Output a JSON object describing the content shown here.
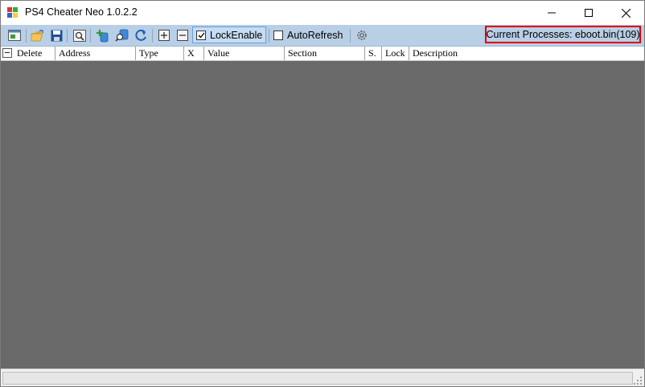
{
  "window": {
    "title": "PS4 Cheater Neo 1.0.2.2",
    "controls": {
      "minimize": "minimize",
      "maximize": "maximize",
      "close": "close"
    }
  },
  "toolbar": {
    "buttons": [
      {
        "name": "new-icon"
      },
      {
        "name": "open-folder-icon"
      },
      {
        "name": "save-icon"
      },
      {
        "name": "search-icon"
      },
      {
        "name": "add-address-icon"
      },
      {
        "name": "pointer-search-icon"
      },
      {
        "name": "refresh-icon"
      },
      {
        "name": "expand-all-icon"
      },
      {
        "name": "collapse-all-icon"
      }
    ],
    "lock_enable": {
      "label": "LockEnable",
      "checked": true
    },
    "auto_refresh": {
      "label": "AutoRefresh",
      "checked": false
    },
    "settings_icon": "gear-icon",
    "current_process": "Current Processes: eboot.bin(109)"
  },
  "grid": {
    "columns": [
      "Delete",
      "Address",
      "Type",
      "X",
      "Value",
      "Section",
      "S.",
      "Lock",
      "Description"
    ],
    "rows": []
  },
  "colors": {
    "toolbar": "#b9cfe6",
    "grid_background": "#696969",
    "highlight_border": "#e00000"
  }
}
